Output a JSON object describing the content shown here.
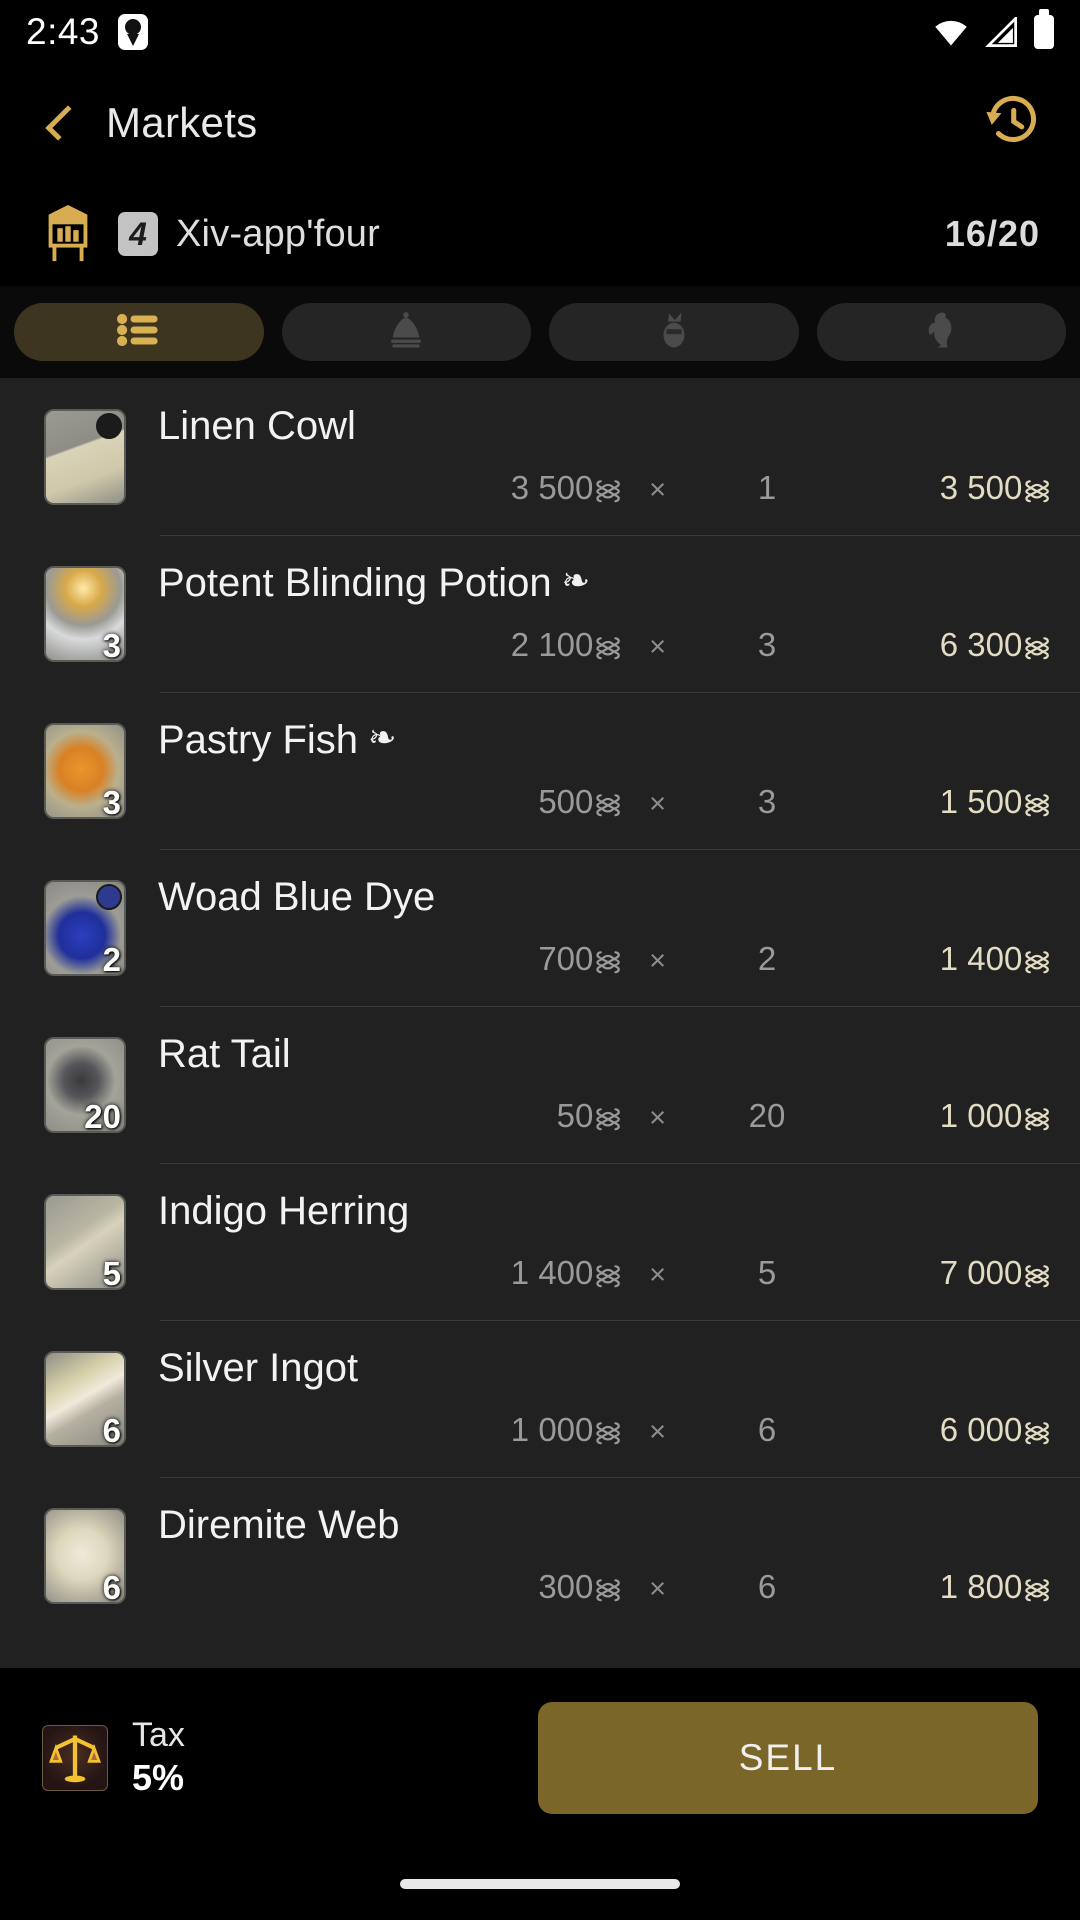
{
  "statusbar": {
    "time": "2:43",
    "app_icon": "game-app-icon",
    "icons": [
      "wifi-icon",
      "cellular-signal-icon",
      "battery-icon"
    ]
  },
  "header": {
    "back_icon": "chevron-left-icon",
    "title": "Markets",
    "history_icon": "history-icon"
  },
  "retainer": {
    "board_icon": "market-board-icon",
    "badge": "4",
    "name": "Xiv-app'four",
    "slots": "16/20"
  },
  "tabs": [
    {
      "id": "tab-list",
      "icon": "list-icon",
      "active": true
    },
    {
      "id": "tab-bell",
      "icon": "bell-icon",
      "active": false
    },
    {
      "id": "tab-gil",
      "icon": "coin-pouch-icon",
      "active": false
    },
    {
      "id": "tab-chocobo",
      "icon": "chocobo-icon",
      "active": false
    }
  ],
  "currency_symbol": "᯼",
  "multiply_symbol": "×",
  "hq_symbol": "❧",
  "items": [
    {
      "name": "Linen Cowl",
      "hq": false,
      "qty_badge": "",
      "unit": "3 500",
      "qty": "1",
      "total": "3 500",
      "icon": "item-linen-cowl-icon",
      "dye": "#1b1b1b"
    },
    {
      "name": "Potent Blinding Potion",
      "hq": true,
      "qty_badge": "3",
      "unit": "2 100",
      "qty": "3",
      "total": "6 300",
      "icon": "item-potion-icon",
      "dye": ""
    },
    {
      "name": "Pastry Fish",
      "hq": true,
      "qty_badge": "3",
      "unit": "500",
      "qty": "3",
      "total": "1 500",
      "icon": "item-pastry-fish-icon",
      "dye": ""
    },
    {
      "name": "Woad Blue Dye",
      "hq": false,
      "qty_badge": "2",
      "unit": "700",
      "qty": "2",
      "total": "1 400",
      "icon": "item-dye-icon",
      "dye": "#2d3b8e"
    },
    {
      "name": "Rat Tail",
      "hq": false,
      "qty_badge": "20",
      "unit": "50",
      "qty": "20",
      "total": "1 000",
      "icon": "item-rat-tail-icon",
      "dye": ""
    },
    {
      "name": "Indigo Herring",
      "hq": false,
      "qty_badge": "5",
      "unit": "1 400",
      "qty": "5",
      "total": "7 000",
      "icon": "item-herring-icon",
      "dye": ""
    },
    {
      "name": "Silver Ingot",
      "hq": false,
      "qty_badge": "6",
      "unit": "1 000",
      "qty": "6",
      "total": "6 000",
      "icon": "item-silver-ingot-icon",
      "dye": ""
    },
    {
      "name": "Diremite Web",
      "hq": false,
      "qty_badge": "6",
      "unit": "300",
      "qty": "6",
      "total": "1 800",
      "icon": "item-diremite-web-icon",
      "dye": ""
    }
  ],
  "bottombar": {
    "tax_icon": "tax-scales-icon",
    "tax_label": "Tax",
    "tax_value": "5%",
    "sell_label": "SELL"
  },
  "colors": {
    "accent_gold": "#d8ad52",
    "total_gold": "#e2dcc3",
    "sell_button": "#7a6628",
    "active_tab": "#3d3520",
    "list_bg": "#212121"
  }
}
